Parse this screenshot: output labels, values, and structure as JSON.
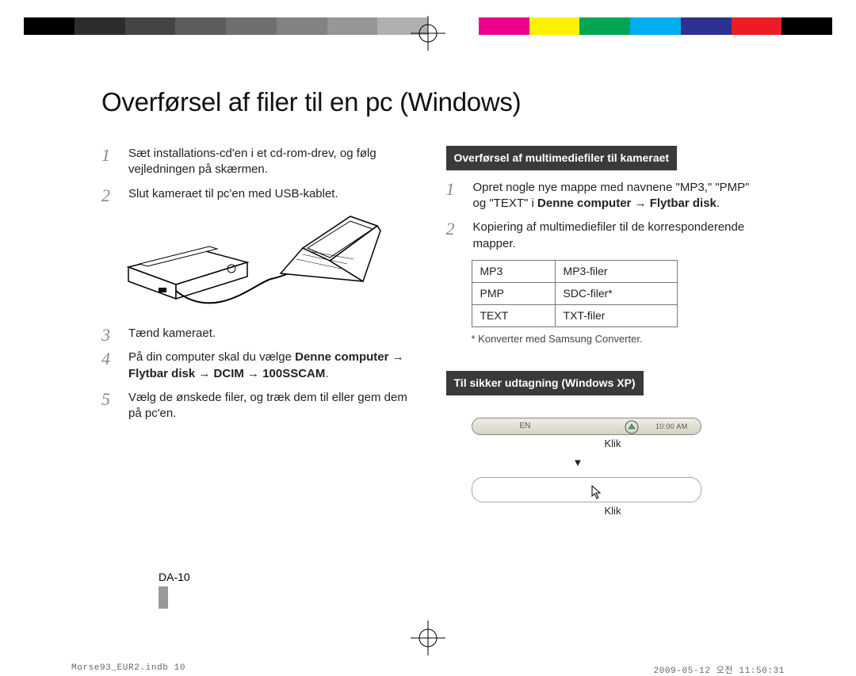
{
  "title": "Overførsel af filer til en pc (Windows)",
  "left": {
    "steps": [
      "Sæt installations-cd'en i et cd-rom-drev, og følg vejledningen på skærmen.",
      "Slut kameraet til pc'en med USB-kablet.",
      "Tænd kameraet.",
      "På din computer skal du vælge Denne computer → Flytbar disk → DCIM → 100SSCAM.",
      "Vælg de ønskede filer, og træk dem til eller gem dem på pc'en."
    ],
    "step4_bold_path": "Denne computer → Flytbar disk → DCIM → 100SSCAM"
  },
  "right_a": {
    "heading": "Overførsel af multimediefiler til kameraet",
    "steps": [
      "Opret nogle nye mappe med navnene \"MP3,\" \"PMP\" og \"TEXT\" i Denne computer → Flytbar disk.",
      "Kopiering af multimediefiler til de korresponderende mapper."
    ],
    "step1_bold": "Denne computer → Flytbar disk",
    "table": [
      {
        "type": "MP3",
        "files": "MP3-filer"
      },
      {
        "type": "PMP",
        "files": "SDC-filer*"
      },
      {
        "type": "TEXT",
        "files": "TXT-filer"
      }
    ],
    "footnote": "* Konverter med Samsung Converter."
  },
  "right_b": {
    "heading": "Til sikker udtagning (Windows XP)",
    "klik": "Klik",
    "arrow": "▼",
    "taskbar": {
      "lang": "EN",
      "clock": "10:00 AM"
    }
  },
  "page_number": "DA-10",
  "printfoot_left": "Morse93_EUR2.indb   10",
  "printfoot_right": "2009-05-12   오전 11:50:31"
}
